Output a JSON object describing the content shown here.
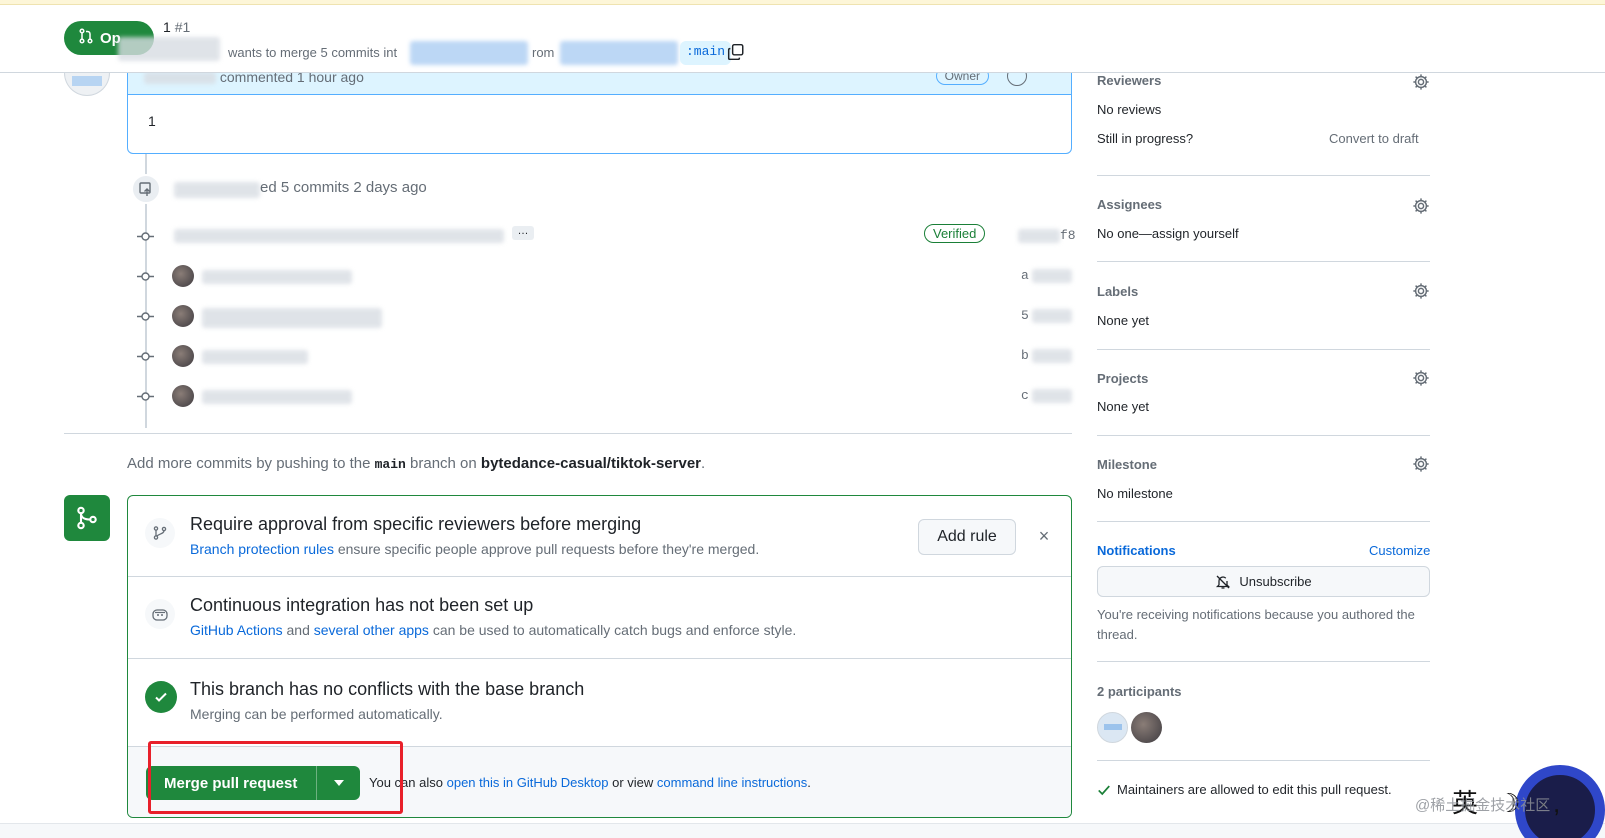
{
  "header": {
    "state_label": "Op",
    "title_prefix": "1",
    "title_number": "#1",
    "meta_text": "wants to merge 5 commits int",
    "meta_from": "rom",
    "head_branch": ":main"
  },
  "comment": {
    "author_action": "commented 1 hour ago",
    "owner_badge": "Owner",
    "body": "1"
  },
  "commits_event": {
    "text": "ed 5 commits 2 days ago",
    "verified_label": "Verified",
    "ellipsis": "…",
    "shas": [
      "f8",
      "a",
      "5",
      "b",
      "c"
    ]
  },
  "add_commits": {
    "prefix": "Add more commits by pushing to the",
    "branch": "main",
    "middle": "branch on",
    "repo": "bytedance-casual/tiktok-server",
    "suffix": "."
  },
  "merge_box": {
    "approval": {
      "title": "Require approval from specific reviewers before merging",
      "link": "Branch protection rules",
      "rest": "ensure specific people approve pull requests before they're merged.",
      "add_rule": "Add rule",
      "close": "×"
    },
    "ci": {
      "title": "Continuous integration has not been set up",
      "link1": "GitHub Actions",
      "and": "and",
      "link2": "several other apps",
      "rest": "can be used to automatically catch bugs and enforce style."
    },
    "conflicts": {
      "title": "This branch has no conflicts with the base branch",
      "sub": "Merging can be performed automatically."
    },
    "footer": {
      "merge_label": "Merge pull request",
      "you_can": "You can also",
      "desktop_link": "open this in GitHub Desktop",
      "or_view": "or view",
      "cli_link": "command line instructions",
      "end": "."
    }
  },
  "sidebar": {
    "reviewers": {
      "label": "Reviewers",
      "value": "No reviews",
      "progress_q": "Still in progress?",
      "draft_link": "Convert to draft"
    },
    "assignees": {
      "label": "Assignees",
      "value": "No one—assign yourself"
    },
    "labels": {
      "label": "Labels",
      "value": "None yet"
    },
    "projects": {
      "label": "Projects",
      "value": "None yet"
    },
    "milestone": {
      "label": "Milestone",
      "value": "No milestone"
    },
    "notifications": {
      "label": "Notifications",
      "customize": "Customize",
      "button": "Unsubscribe",
      "reason": "You're receiving notifications because you authored the thread."
    },
    "participants": {
      "label": "2 participants"
    },
    "maintainers": "Maintainers are allowed to edit this pull request."
  },
  "overlay": {
    "watermark": "@稀土掘金技术社区",
    "ime": "英 ☽ ∙,"
  },
  "colors": {
    "accent_green": "#1f883d",
    "link_blue": "#0969da",
    "highlight_red": "#e8202a"
  }
}
